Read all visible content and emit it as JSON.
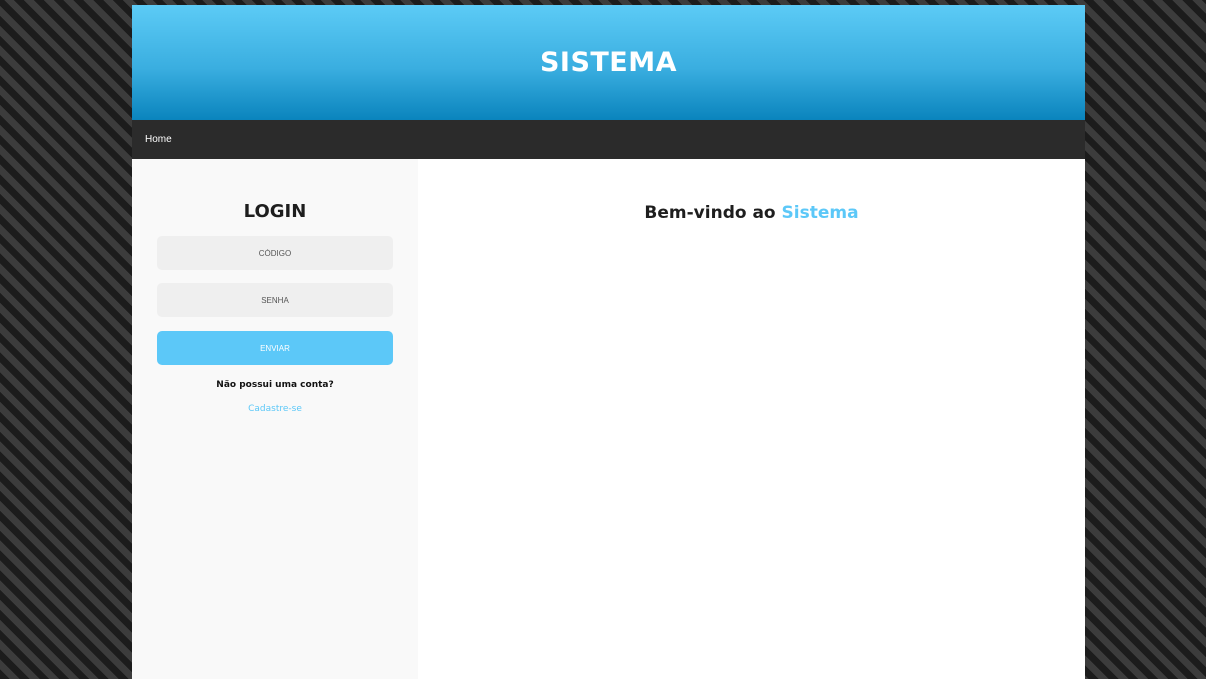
{
  "header": {
    "title": "SISTEMA"
  },
  "nav": {
    "home_label": "Home"
  },
  "login": {
    "title": "LOGIN",
    "code_placeholder": "CÓDIGO",
    "password_placeholder": "SENHA",
    "submit_label": "ENVIAR",
    "no_account_text": "Não possui uma conta?",
    "signup_link": "Cadastre-se"
  },
  "main": {
    "welcome_prefix": "Bem-vindo ao ",
    "welcome_highlight": "Sistema"
  },
  "colors": {
    "accent": "#5cc8f8",
    "header_top": "#5ccbf6",
    "header_bottom": "#0a84bd",
    "navbar": "#2b2b2b",
    "sidebar": "#f9f9f9"
  }
}
